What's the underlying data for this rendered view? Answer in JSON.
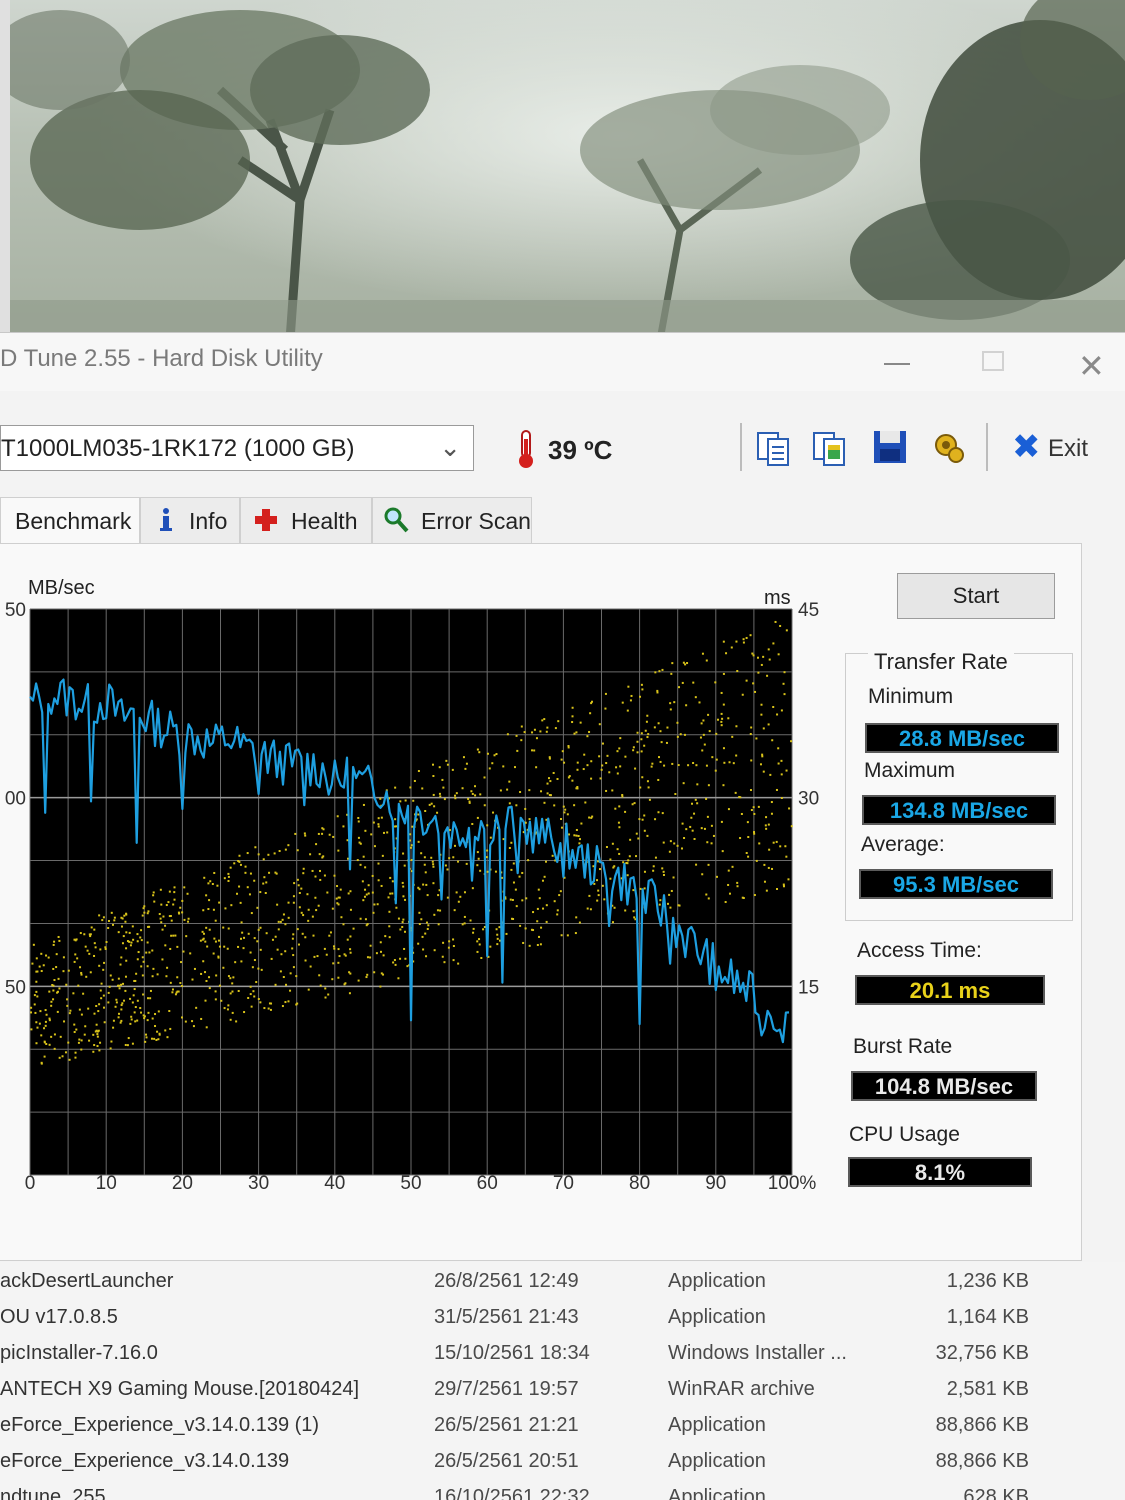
{
  "window": {
    "title": "D Tune 2.55 - Hard Disk Utility",
    "close_glyph": "✕"
  },
  "toolbar": {
    "drive": "T1000LM035-1RK172 (1000 GB)",
    "temperature": "39 ºC",
    "exit_label": "Exit",
    "icons": [
      "copy-text-icon",
      "copy-image-icon",
      "save-icon",
      "options-icon",
      "exit-icon"
    ]
  },
  "tabs": [
    {
      "label": "Benchmark",
      "icon": "",
      "active": true
    },
    {
      "label": "Info",
      "icon": "info-icon",
      "active": false
    },
    {
      "label": "Health",
      "icon": "health-cross-icon",
      "active": false
    },
    {
      "label": "Error Scan",
      "icon": "magnifier-icon",
      "active": false
    }
  ],
  "benchmark": {
    "start_label": "Start",
    "transfer_rate_title": "Transfer Rate",
    "minimum_label": "Minimum",
    "minimum_value": "28.8 MB/sec",
    "maximum_label": "Maximum",
    "maximum_value": "134.8 MB/sec",
    "average_label": "Average:",
    "average_value": "95.3 MB/sec",
    "access_time_label": "Access Time:",
    "access_time_value": "20.1 ms",
    "burst_rate_label": "Burst Rate",
    "burst_rate_value": "104.8 MB/sec",
    "cpu_usage_label": "CPU Usage",
    "cpu_usage_value": "8.1%"
  },
  "chart_data": {
    "type": "line",
    "ylabel_left": "MB/sec",
    "ylabel_right": "ms",
    "x_ticks": [
      "0",
      "10",
      "20",
      "30",
      "40",
      "50",
      "60",
      "70",
      "80",
      "90",
      "100%"
    ],
    "y_left_ticks": [
      "50",
      "00",
      "50"
    ],
    "y_right_ticks": [
      "45",
      "30",
      "15"
    ],
    "xlim": [
      0,
      100
    ],
    "ylim_left": [
      0,
      150
    ],
    "ylim_right": [
      0,
      45
    ],
    "grid": true,
    "colors": {
      "background": "#000000",
      "grid": "#6a6a6a",
      "transfer": "#1e9fe0",
      "access": "#d9c31a"
    },
    "series": [
      {
        "kind": "transfer",
        "x": [
          0,
          2,
          4,
          6,
          8,
          10,
          12,
          14,
          16,
          18,
          20,
          22,
          24,
          26,
          28,
          30,
          32,
          34,
          36,
          38,
          40,
          42,
          44,
          46,
          48,
          50,
          52,
          54,
          56,
          58,
          60,
          62,
          64,
          66,
          68,
          70,
          72,
          74,
          76,
          78,
          80,
          82,
          84,
          86,
          88,
          90,
          92,
          94,
          96,
          98,
          100
        ],
        "y": [
          124,
          128,
          127,
          126,
          124,
          126,
          121,
          123,
          120,
          118,
          117,
          116,
          114,
          116,
          113,
          112,
          110,
          109,
          109,
          108,
          104,
          106,
          103,
          103,
          98,
          97,
          95,
          94,
          90,
          94,
          93,
          94,
          93,
          91,
          89,
          88,
          84,
          82,
          79,
          78,
          74,
          72,
          68,
          63,
          59,
          55,
          52,
          49,
          45,
          42,
          39
        ],
        "dips": [
          [
            2,
            96
          ],
          [
            8,
            99
          ],
          [
            14,
            88
          ],
          [
            20,
            97
          ],
          [
            30,
            101
          ],
          [
            36,
            98
          ],
          [
            42,
            81
          ],
          [
            48,
            72
          ],
          [
            50,
            41
          ],
          [
            54,
            73
          ],
          [
            58,
            78
          ],
          [
            60,
            58
          ],
          [
            62,
            51
          ],
          [
            64,
            80
          ],
          [
            70,
            79
          ],
          [
            76,
            66
          ],
          [
            80,
            40
          ],
          [
            84,
            56
          ],
          [
            90,
            49
          ],
          [
            96,
            37
          ]
        ]
      },
      {
        "kind": "access",
        "note_band": "scatter",
        "x": [
          0,
          5,
          10,
          15,
          20,
          25,
          30,
          35,
          40,
          45,
          50,
          55,
          60,
          65,
          70,
          75,
          80,
          85,
          90,
          95,
          100
        ],
        "y": [
          13.5,
          14.5,
          15.5,
          16.5,
          17.5,
          18.5,
          19.5,
          20.5,
          21.5,
          22.5,
          24,
          25,
          26,
          27,
          28,
          29,
          30,
          31,
          32,
          33,
          34
        ]
      }
    ]
  },
  "filelist": [
    {
      "name": "ackDesertLauncher",
      "date": "26/8/2561 12:49",
      "type": "Application",
      "size": "1,236 KB"
    },
    {
      "name": "OU v17.0.8.5",
      "date": "31/5/2561 21:43",
      "type": "Application",
      "size": "1,164 KB"
    },
    {
      "name": "picInstaller-7.16.0",
      "date": "15/10/2561 18:34",
      "type": "Windows Installer ...",
      "size": "32,756 KB"
    },
    {
      "name": "ANTECH X9 Gaming Mouse.[20180424]",
      "date": "29/7/2561 19:57",
      "type": "WinRAR archive",
      "size": "2,581 KB"
    },
    {
      "name": "eForce_Experience_v3.14.0.139 (1)",
      "date": "26/5/2561 21:21",
      "type": "Application",
      "size": "88,866 KB"
    },
    {
      "name": "eForce_Experience_v3.14.0.139",
      "date": "26/5/2561 20:51",
      "type": "Application",
      "size": "88,866 KB"
    },
    {
      "name": "ndtune_255",
      "date": "16/10/2561 22:32",
      "type": "Application",
      "size": "628 KB"
    }
  ]
}
